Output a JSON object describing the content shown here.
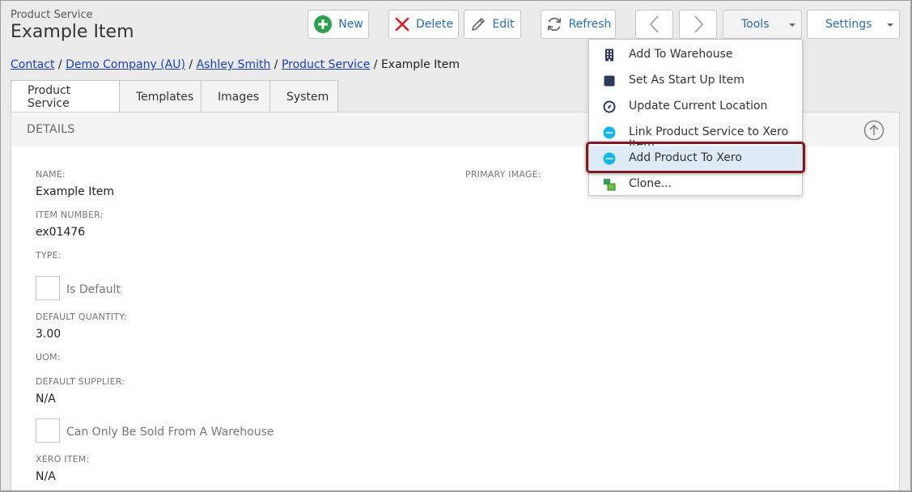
{
  "header": {
    "subtitle": "Product Service",
    "title": "Example Item"
  },
  "toolbar": {
    "new_label": "New",
    "delete_label": "Delete",
    "edit_label": "Edit",
    "refresh_label": "Refresh",
    "tools_label": "Tools",
    "settings_label": "Settings"
  },
  "breadcrumb": {
    "items": [
      "Contact",
      "Demo Company (AU)",
      "Ashley Smith",
      "Product Service"
    ],
    "current": "Example Item",
    "separator": " / "
  },
  "tabs": [
    {
      "label": "Product Service",
      "active": true
    },
    {
      "label": "Templates"
    },
    {
      "label": "Images"
    },
    {
      "label": "System"
    }
  ],
  "details": {
    "heading": "DETAILS",
    "name_label": "NAME:",
    "name_value": "Example Item",
    "primary_image_label": "PRIMARY IMAGE:",
    "item_number_label": "ITEM NUMBER:",
    "item_number_value": "ex01476",
    "type_label": "TYPE:",
    "is_default_label": "Is Default",
    "default_quantity_label": "DEFAULT QUANTITY:",
    "default_quantity_value": "3.00",
    "uom_label": "UOM:",
    "default_supplier_label": "DEFAULT SUPPLIER:",
    "default_supplier_value": "N/A",
    "warehouse_only_label": "Can Only Be Sold From A Warehouse",
    "xero_item_label": "XERO ITEM:",
    "xero_item_value": "N/A"
  },
  "tools_menu": {
    "items": [
      {
        "label": "Add To Warehouse",
        "icon": "building-icon"
      },
      {
        "label": "Set As Start Up Item",
        "icon": "square-icon"
      },
      {
        "label": "Update Current Location",
        "icon": "compass-icon"
      },
      {
        "label": "Link Product Service to Xero Item",
        "icon": "xero-icon"
      },
      {
        "label": "Add Product To Xero",
        "icon": "xero-icon",
        "highlighted": true
      },
      {
        "label": "Clone...",
        "icon": "clone-icon"
      }
    ]
  },
  "colors": {
    "accent": "#2a6db0",
    "new_green": "#2e9e4f",
    "delete_red": "#d0202a",
    "xero_blue": "#13b5ea",
    "highlight_ring": "#7d1a24"
  }
}
